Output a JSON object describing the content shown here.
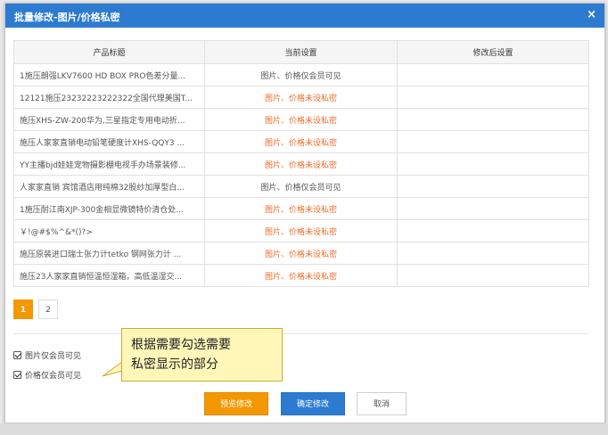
{
  "dialog": {
    "title": "批量修改-图片/价格私密",
    "close_label": "×"
  },
  "table": {
    "headers": [
      "产品标题",
      "当前设置",
      "修改后设置"
    ],
    "rows": [
      {
        "title": "1施压朗强LKV7600 HD BOX PRO色差分量...",
        "status": "图片、价格仅会员可见",
        "kind": "member"
      },
      {
        "title": "12121施压23232223222322全国代理美国T...",
        "status": "图片、价格未设私密",
        "kind": "unset"
      },
      {
        "title": "施压XHS-ZW-200华为,三星指定专用电动折...",
        "status": "图片、价格未设私密",
        "kind": "unset"
      },
      {
        "title": "施压人家家直销电动铅笔硬度计XHS-QQY3 ...",
        "status": "图片、价格未设私密",
        "kind": "unset"
      },
      {
        "title": "YY主播bjd娃娃宠物摄影棚电视手办场景装修...",
        "status": "图片、价格未设私密",
        "kind": "unset"
      },
      {
        "title": "人家家直销 宾馆酒店用纯棉32股纱加厚型白...",
        "status": "图片、价格仅会员可见",
        "kind": "member"
      },
      {
        "title": "1施压耐江南XJP-300金相显微镜特价清仓处...",
        "status": "图片、价格未设私密",
        "kind": "unset"
      },
      {
        "title": "￥!@#$%^&*()?>",
        "status": "图片、价格未设私密",
        "kind": "unset"
      },
      {
        "title": "施压原装进口瑞士张力计tetko 钢网张力计 ...",
        "status": "图片、价格未设私密",
        "kind": "unset"
      },
      {
        "title": "施压23人家家直销恒温恒湿箱，高低温湿交...",
        "status": "图片、价格未设私密",
        "kind": "unset"
      }
    ]
  },
  "pager": {
    "pages": [
      "1",
      "2"
    ],
    "active": "1"
  },
  "options": {
    "image_member": "图片仅会员可见",
    "price_member": "价格仅会员可见"
  },
  "callout": {
    "line1": "根据需要勾选需要",
    "line2": "私密显示的部分"
  },
  "buttons": {
    "preview": "预览修改",
    "confirm": "确定修改",
    "cancel": "取消"
  },
  "colors": {
    "titlebar": "#2d7bd0",
    "accent_orange": "#f39800",
    "status_unset": "#f06c29"
  }
}
